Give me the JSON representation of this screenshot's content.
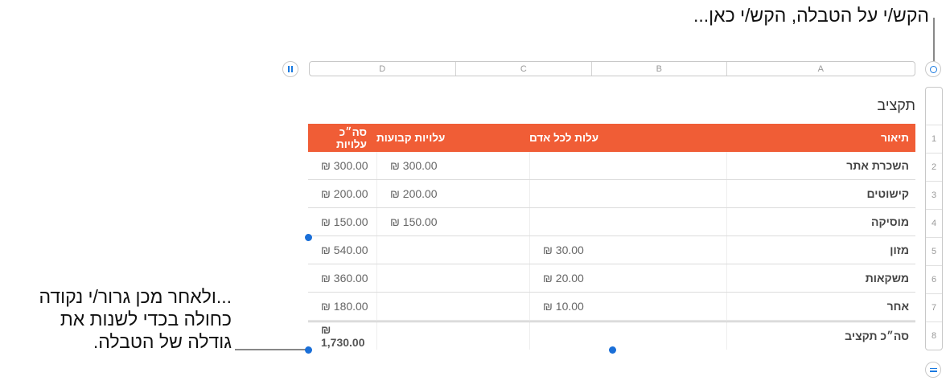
{
  "callout_top": "הקש/י על הטבלה, הקש/י כאן...",
  "callout_left_lines": [
    "...ולאחר מכן גרור/י נקודה",
    "כחולה בכדי לשנות את",
    "גודלה של הטבלה."
  ],
  "column_headers": [
    "A",
    "B",
    "C",
    "D"
  ],
  "row_numbers": [
    "1",
    "2",
    "3",
    "4",
    "5",
    "6",
    "7",
    "8"
  ],
  "table": {
    "title": "תקציב",
    "headers": {
      "description": "תיאור",
      "per_person": "עלות לכל אדם",
      "fixed": "עלויות קבועות",
      "total": "סה״כ עלויות"
    },
    "rows": [
      {
        "description": "השכרת אתר",
        "per_person": "",
        "fixed": "₪ 300.00",
        "total": "₪ 300.00"
      },
      {
        "description": "קישוטים",
        "per_person": "",
        "fixed": "₪ 200.00",
        "total": "₪ 200.00"
      },
      {
        "description": "מוסיקה",
        "per_person": "",
        "fixed": "₪ 150.00",
        "total": "₪ 150.00"
      },
      {
        "description": "מזון",
        "per_person": "₪ 30.00",
        "fixed": "",
        "total": "₪ 540.00"
      },
      {
        "description": "משקאות",
        "per_person": "₪ 20.00",
        "fixed": "",
        "total": "₪ 360.00"
      },
      {
        "description": "אחר",
        "per_person": "₪ 10.00",
        "fixed": "",
        "total": "₪ 180.00"
      }
    ],
    "footer": {
      "description": "סה״כ תקציב",
      "per_person": "",
      "fixed": "",
      "total": "₪ 1,730.00"
    }
  },
  "colors": {
    "header_fill": "#f05d36",
    "handle_blue": "#1a6fd8",
    "accent_blue": "#1a7ae0"
  },
  "icons": {
    "select_table": "circle-icon",
    "column_resize": "pause-icon",
    "row_resize": "equals-icon"
  }
}
